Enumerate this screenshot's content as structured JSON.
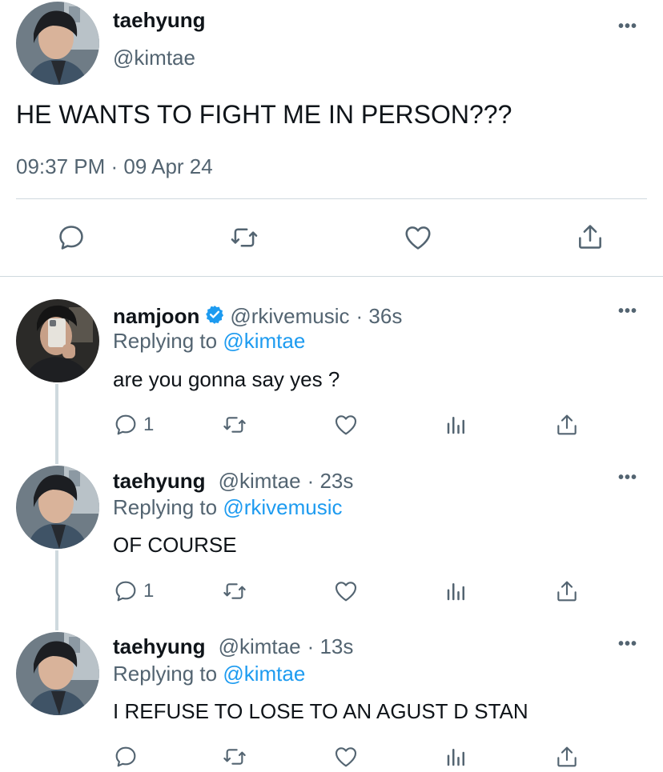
{
  "main_tweet": {
    "display_name": "taehyung",
    "handle": "@kimtae",
    "text": "HE WANTS TO FIGHT ME IN PERSON???",
    "timestamp": "09:37 PM · 09 Apr 24",
    "more_icon": "more-dots-icon"
  },
  "replies": [
    {
      "display_name": "namjoon",
      "verified": true,
      "handle": "@rkivemusic",
      "time": "· 36s",
      "replying_label": "Replying to",
      "replying_to": "@kimtae",
      "text": "are you gonna say yes ?",
      "reply_count": "1"
    },
    {
      "display_name": "taehyung",
      "verified": false,
      "handle": "@kimtae",
      "time": "· 23s",
      "replying_label": "Replying to",
      "replying_to": "@rkivemusic",
      "text": "OF COURSE",
      "reply_count": "1"
    },
    {
      "display_name": "taehyung",
      "verified": false,
      "handle": "@kimtae",
      "time": "· 13s",
      "replying_label": "Replying to",
      "replying_to": "@kimtae",
      "text": "I REFUSE TO LOSE TO AN AGUST D STAN",
      "reply_count": ""
    }
  ],
  "colors": {
    "text": "#0f1419",
    "muted": "#536471",
    "link": "#1d9bf0",
    "divider": "#cfd9de"
  }
}
